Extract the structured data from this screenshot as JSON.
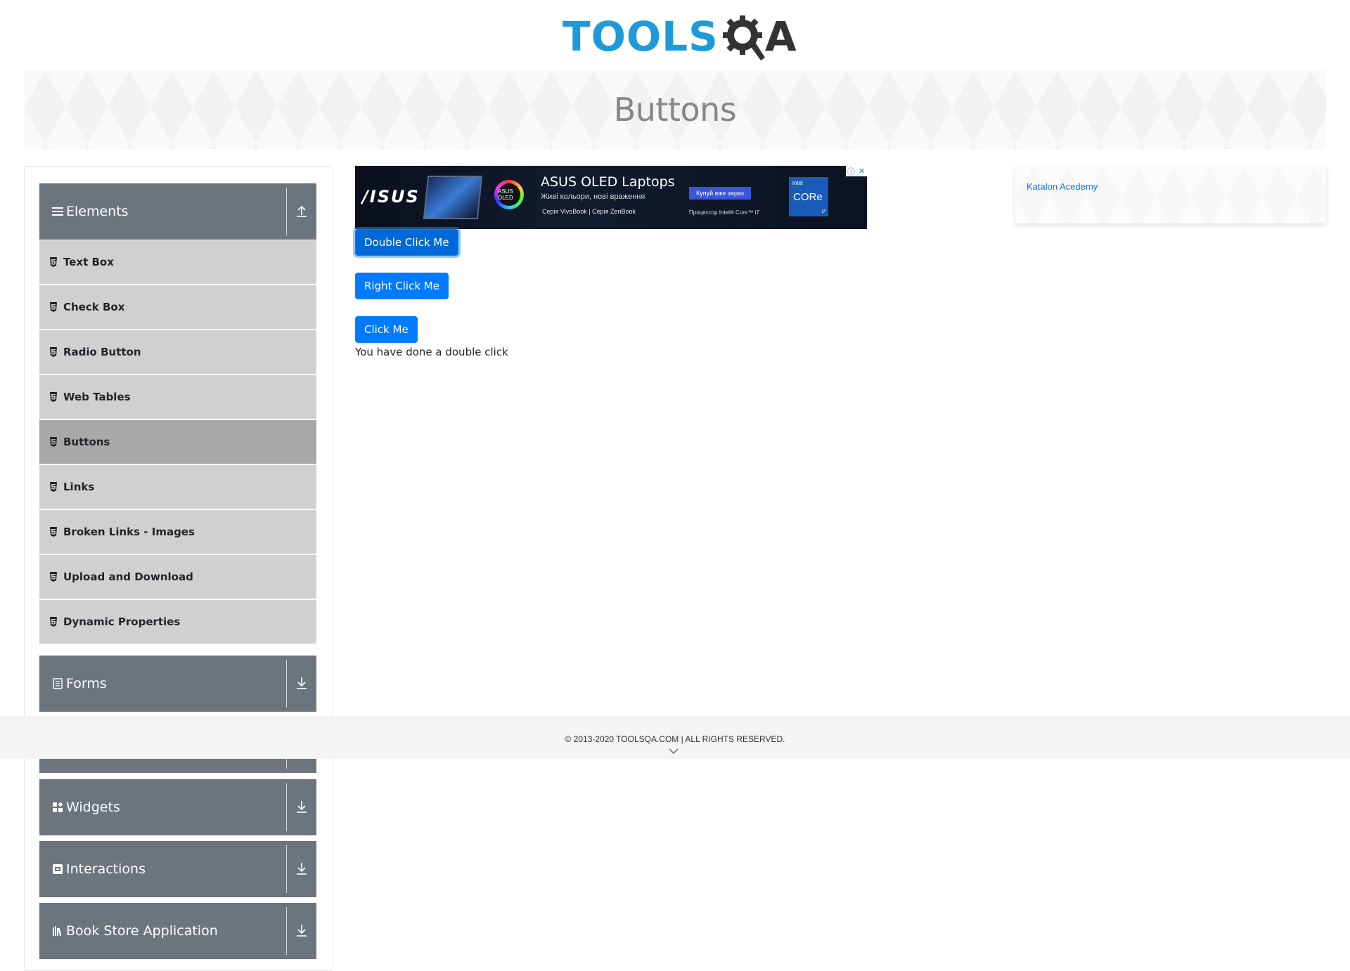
{
  "header": {
    "logo_text_tools": "TOOLS",
    "logo_text_a": "A",
    "page_title": "Buttons"
  },
  "sidebar": {
    "groups": [
      {
        "label": "Elements",
        "icon": "hamburger-icon",
        "toggle": "collapse-up-icon"
      },
      {
        "label": "Forms",
        "icon": "form-icon",
        "toggle": "expand-down-icon"
      },
      {
        "label": "Widgets",
        "icon": "widgets-icon",
        "toggle": "expand-down-icon"
      },
      {
        "label": "Interactions",
        "icon": "interactions-icon",
        "toggle": "expand-down-icon"
      },
      {
        "label": "Book Store Application",
        "icon": "bookstore-icon",
        "toggle": "expand-down-icon"
      }
    ],
    "items": [
      {
        "label": "Text Box"
      },
      {
        "label": "Check Box"
      },
      {
        "label": "Radio Button"
      },
      {
        "label": "Web Tables"
      },
      {
        "label": "Buttons",
        "active": true
      },
      {
        "label": "Links"
      },
      {
        "label": "Broken Links - Images"
      },
      {
        "label": "Upload and Download"
      },
      {
        "label": "Dynamic Properties"
      }
    ]
  },
  "ad": {
    "brand": "/ISUS",
    "oled_badge": "ASUS OLED",
    "title": "ASUS OLED Laptops",
    "subtitle": "Живі кольори, нові враження",
    "series": "Серія VivoBook | Серія ZenBook",
    "cta": "Купуй вже зараз",
    "processor": "Процессор Intel® Core™ i7",
    "intel_brand": "intel",
    "intel_core": "CORe",
    "intel_tier": "i7",
    "info": "ⓘ",
    "close": "✕"
  },
  "main": {
    "double_click_button": "Double Click Me",
    "right_click_button": "Right Click Me",
    "click_button": "Click Me",
    "message": "You have done a double click"
  },
  "right_ad": {
    "alt_text": "Katalon Acedemy"
  },
  "footer": {
    "copyright": "© 2013-2020 TOOLSQA.COM | ALL RIGHTS RESERVED."
  },
  "colors": {
    "brand_blue": "#1e9bd7",
    "primary_button": "#007bff",
    "group_header": "#6c757d",
    "menu_item": "#d0d0d0",
    "menu_item_active": "#a8a8a8"
  }
}
